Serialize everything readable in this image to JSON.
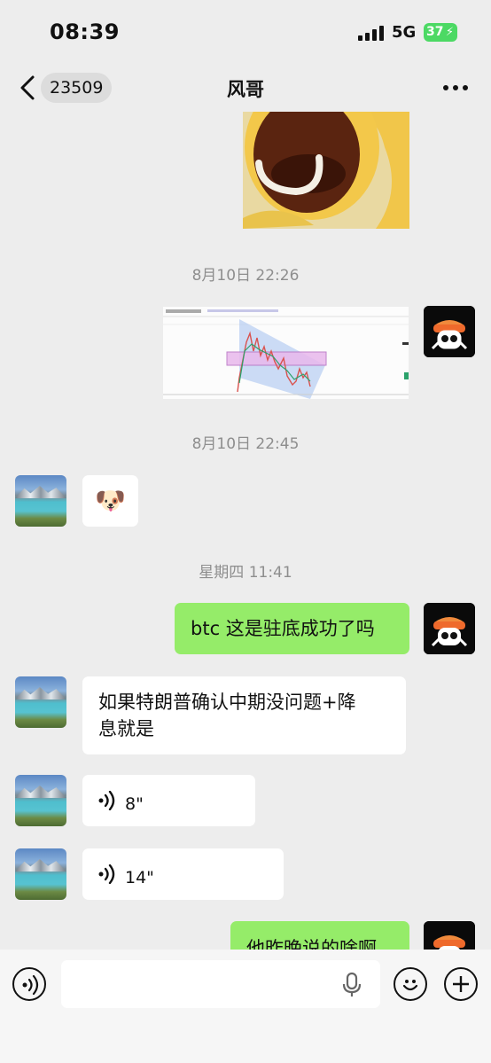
{
  "status_bar": {
    "time": "08:39",
    "network": "5G",
    "battery": "37"
  },
  "header": {
    "back_count": "23509",
    "title": "风哥"
  },
  "messages": [
    {
      "kind": "image",
      "side": "in",
      "desc": "sticker-partial"
    },
    {
      "kind": "timestamp",
      "text": "8月10日 22:26"
    },
    {
      "kind": "image",
      "side": "out",
      "desc": "chart-screenshot"
    },
    {
      "kind": "timestamp",
      "text": "8月10日 22:45"
    },
    {
      "kind": "emoji",
      "side": "in",
      "emoji": "🐶"
    },
    {
      "kind": "timestamp",
      "text": "星期四 11:41"
    },
    {
      "kind": "text",
      "side": "out",
      "text": "btc 这是驻底成功了吗"
    },
    {
      "kind": "text",
      "side": "in",
      "line1": "如果特朗普确认中期没问题+降",
      "line2": "息就是"
    },
    {
      "kind": "voice",
      "side": "in",
      "duration": "8\""
    },
    {
      "kind": "voice",
      "side": "in",
      "duration": "14\""
    },
    {
      "kind": "text",
      "side": "out",
      "text": "他昨晚说的啥啊"
    }
  ],
  "colors": {
    "background": "#ededed",
    "bubble_out": "#95ec69",
    "bubble_in": "#ffffff",
    "battery": "#4cd964"
  },
  "input_bar": {
    "placeholder": ""
  }
}
